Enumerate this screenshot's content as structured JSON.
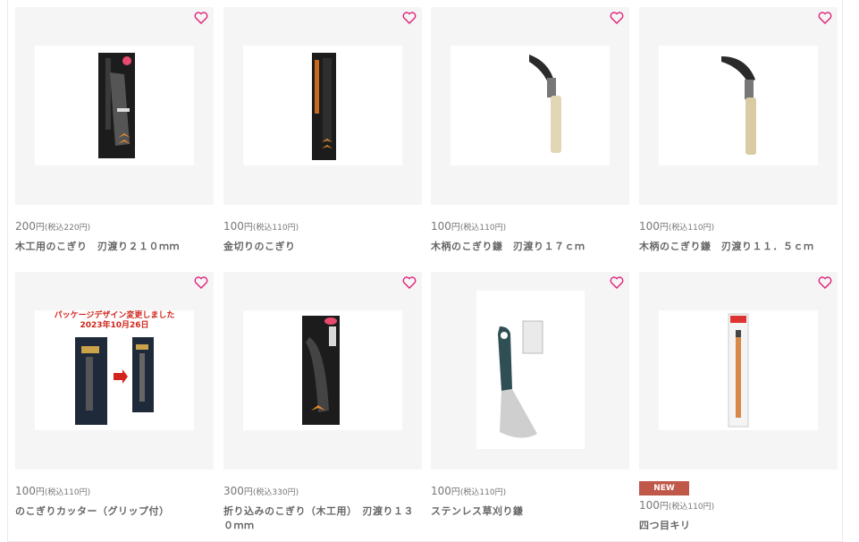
{
  "products": [
    {
      "price": "200",
      "yen": "円",
      "tax": "(税込220円)",
      "name": "木工用のこぎり　刃渡り２１０ｍｍ",
      "badge": "",
      "image_desc": "woodwork-saw-package-icon"
    },
    {
      "price": "100",
      "yen": "円",
      "tax": "(税込110円)",
      "name": "金切りのこぎり",
      "badge": "",
      "image_desc": "metal-saw-package-icon"
    },
    {
      "price": "100",
      "yen": "円",
      "tax": "(税込110円)",
      "name": "木柄のこぎり鎌　刃渡り１７ｃｍ",
      "badge": "",
      "image_desc": "sickle-icon"
    },
    {
      "price": "100",
      "yen": "円",
      "tax": "(税込110円)",
      "name": "木柄のこぎり鎌　刃渡り１１．５ｃｍ",
      "badge": "",
      "image_desc": "sickle-icon"
    },
    {
      "price": "100",
      "yen": "円",
      "tax": "(税込110円)",
      "name": "のこぎりカッター（グリップ付）",
      "badge": "",
      "image_desc": "saw-cutter-package-icon",
      "notice_line1": "パッケージデザイン変更しました",
      "notice_line2": "2023年10月26日"
    },
    {
      "price": "300",
      "yen": "円",
      "tax": "(税込330円)",
      "name": "折り込みのこぎり（木工用）　刃渡り１３０ｍｍ",
      "badge": "",
      "image_desc": "folding-saw-package-icon"
    },
    {
      "price": "100",
      "yen": "円",
      "tax": "(税込110円)",
      "name": "ステンレス草刈り鎌",
      "badge": "",
      "image_desc": "stainless-sickle-icon"
    },
    {
      "price": "100",
      "yen": "円",
      "tax": "(税込110円)",
      "name": "四つ目キリ",
      "badge": "NEW",
      "image_desc": "awl-package-icon"
    }
  ],
  "colors": {
    "heart": "#e0207a",
    "badge": "#c0584a",
    "card_bg": "#f5f5f5"
  }
}
